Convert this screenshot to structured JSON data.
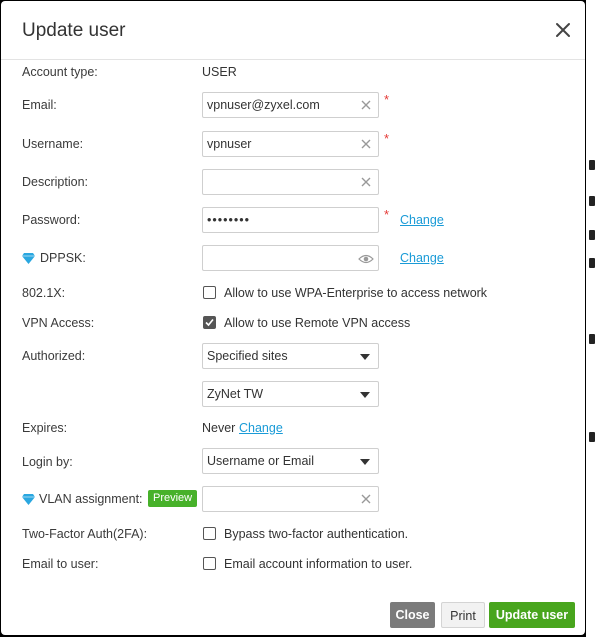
{
  "dialog": {
    "title": "Update user"
  },
  "form": {
    "account_type": {
      "label": "Account type:",
      "value": "USER"
    },
    "email": {
      "label": "Email:",
      "value": "vpnuser@zyxel.com",
      "required": "*"
    },
    "username": {
      "label": "Username:",
      "value": "vpnuser",
      "required": "*"
    },
    "description": {
      "label": "Description:",
      "value": ""
    },
    "password": {
      "label": "Password:",
      "value": "••••••••",
      "required": "*",
      "change": "Change"
    },
    "dppsk": {
      "label": "DPPSK:",
      "value": "",
      "change": "Change"
    },
    "dot1x": {
      "label": "802.1X:",
      "checkbox_label": "Allow to use WPA-Enterprise to access network",
      "checked": false
    },
    "vpn_access": {
      "label": "VPN Access:",
      "checkbox_label": "Allow to use Remote VPN access",
      "checked": true
    },
    "authorized": {
      "label": "Authorized:",
      "scope": "Specified sites",
      "site": "ZyNet TW"
    },
    "expires": {
      "label": "Expires:",
      "value": "Never",
      "change": "Change"
    },
    "login_by": {
      "label": "Login by:",
      "value": "Username or Email"
    },
    "vlan": {
      "label": "VLAN assignment:",
      "badge": "Preview",
      "value": ""
    },
    "two_factor": {
      "label": "Two-Factor Auth(2FA):",
      "checkbox_label": "Bypass two-factor authentication.",
      "checked": false
    },
    "email_to_user": {
      "label": "Email to user:",
      "checkbox_label": "Email account information to user.",
      "checked": false
    }
  },
  "footer": {
    "close": "Close",
    "print": "Print",
    "update": "Update user"
  },
  "colors": {
    "primary": "#48a51d",
    "link": "#1a9bd7",
    "required": "#e53935",
    "badge": "#47b12a",
    "gem": "#2aa7e0"
  }
}
